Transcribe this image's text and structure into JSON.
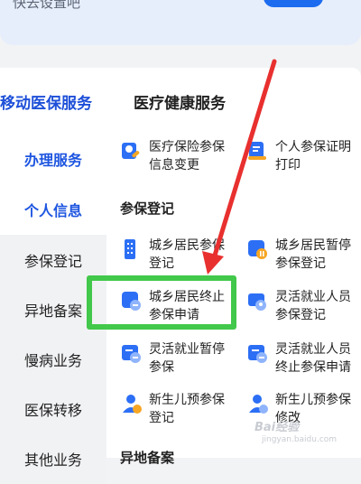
{
  "banner": {
    "text": "快去设置吧"
  },
  "left_nav": {
    "header": "移动医保服务",
    "items": [
      {
        "label": "办理服务"
      },
      {
        "label": "个人信息"
      },
      {
        "label": "参保登记"
      },
      {
        "label": "异地备案"
      },
      {
        "label": "慢病业务"
      },
      {
        "label": "医保转移"
      },
      {
        "label": "其他业务"
      }
    ]
  },
  "main": {
    "section_title": "医疗健康服务",
    "health_services": [
      {
        "label": "医疗保险参保信息变更",
        "icon": "insurance-edit-icon"
      },
      {
        "label": "个人参保证明打印",
        "icon": "print-icon"
      }
    ],
    "group_title": "参保登记",
    "registration_services": [
      {
        "label": "城乡居民参保登记",
        "icon": "building-icon"
      },
      {
        "label": "城乡居民暂停参保登记",
        "icon": "pause-registration-icon"
      },
      {
        "label": "城乡居民终止参保申请",
        "icon": "city-terminate-icon"
      },
      {
        "label": "灵活就业人员参保登记",
        "icon": "flexible-register-icon"
      },
      {
        "label": "灵活就业暂停参保",
        "icon": "flexible-pause-icon"
      },
      {
        "label": "灵活就业人员终止参保申请",
        "icon": "flexible-terminate-icon"
      },
      {
        "label": "新生儿预参保登记",
        "icon": "newborn-icon"
      },
      {
        "label": "新生儿预参保修改",
        "icon": "newborn-edit-icon"
      }
    ],
    "next_group_title": "异地备案"
  },
  "colors": {
    "accent": "#1d55e0",
    "highlight": "#42c84a",
    "arrow": "#e8302f"
  },
  "watermark": {
    "text": "Bai经验",
    "sub": "jingyan.baidu.com"
  }
}
